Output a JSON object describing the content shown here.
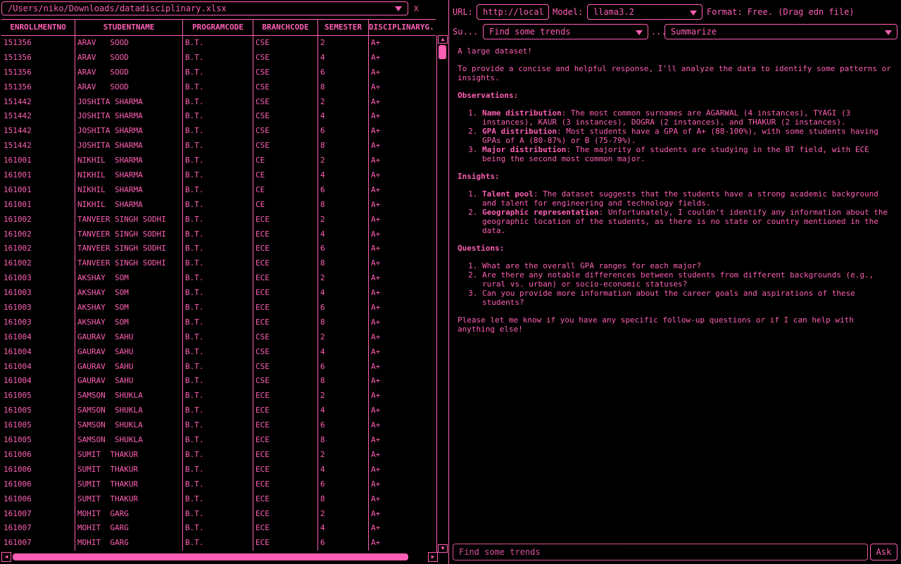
{
  "file": {
    "path": "/Users/niko/Downloads/datadisciplinary.xlsx",
    "close": "X"
  },
  "table": {
    "headers": [
      "ENROLLMENTNO",
      "STUDENTNAME",
      "PROGRAMCODE",
      "BRANCHCODE",
      "SEMESTER",
      "DISCIPLINARYG..."
    ],
    "rows": [
      [
        "151356",
        "ARAV   SOOD",
        "B.T.",
        "CSE",
        "2",
        "A+"
      ],
      [
        "151356",
        "ARAV   SOOD",
        "B.T.",
        "CSE",
        "4",
        "A+"
      ],
      [
        "151356",
        "ARAV   SOOD",
        "B.T.",
        "CSE",
        "6",
        "A+"
      ],
      [
        "151356",
        "ARAV   SOOD",
        "B.T.",
        "CSE",
        "8",
        "A+"
      ],
      [
        "151442",
        "JOSHITA SHARMA",
        "B.T.",
        "CSE",
        "2",
        "A+"
      ],
      [
        "151442",
        "JOSHITA SHARMA",
        "B.T.",
        "CSE",
        "4",
        "A+"
      ],
      [
        "151442",
        "JOSHITA SHARMA",
        "B.T.",
        "CSE",
        "6",
        "A+"
      ],
      [
        "151442",
        "JOSHITA SHARMA",
        "B.T.",
        "CSE",
        "8",
        "A+"
      ],
      [
        "161001",
        "NIKHIL  SHARMA",
        "B.T.",
        "CE",
        "2",
        "A+"
      ],
      [
        "161001",
        "NIKHIL  SHARMA",
        "B.T.",
        "CE",
        "4",
        "A+"
      ],
      [
        "161001",
        "NIKHIL  SHARMA",
        "B.T.",
        "CE",
        "6",
        "A+"
      ],
      [
        "161001",
        "NIKHIL  SHARMA",
        "B.T.",
        "CE",
        "8",
        "A+"
      ],
      [
        "161002",
        "TANVEER SINGH SODHI",
        "B.T.",
        "ECE",
        "2",
        "A+"
      ],
      [
        "161002",
        "TANVEER SINGH SODHI",
        "B.T.",
        "ECE",
        "4",
        "A+"
      ],
      [
        "161002",
        "TANVEER SINGH SODHI",
        "B.T.",
        "ECE",
        "6",
        "A+"
      ],
      [
        "161002",
        "TANVEER SINGH SODHI",
        "B.T.",
        "ECE",
        "8",
        "A+"
      ],
      [
        "161003",
        "AKSHAY  SOM",
        "B.T.",
        "ECE",
        "2",
        "A+"
      ],
      [
        "161003",
        "AKSHAY  SOM",
        "B.T.",
        "ECE",
        "4",
        "A+"
      ],
      [
        "161003",
        "AKSHAY  SOM",
        "B.T.",
        "ECE",
        "6",
        "A+"
      ],
      [
        "161003",
        "AKSHAY  SOM",
        "B.T.",
        "ECE",
        "8",
        "A+"
      ],
      [
        "161004",
        "GAURAV  SAHU",
        "B.T.",
        "CSE",
        "2",
        "A+"
      ],
      [
        "161004",
        "GAURAV  SAHU",
        "B.T.",
        "CSE",
        "4",
        "A+"
      ],
      [
        "161004",
        "GAURAV  SAHU",
        "B.T.",
        "CSE",
        "6",
        "A+"
      ],
      [
        "161004",
        "GAURAV  SAHU",
        "B.T.",
        "CSE",
        "8",
        "A+"
      ],
      [
        "161005",
        "SAMSON  SHUKLA",
        "B.T.",
        "ECE",
        "2",
        "A+"
      ],
      [
        "161005",
        "SAMSON  SHUKLA",
        "B.T.",
        "ECE",
        "4",
        "A+"
      ],
      [
        "161005",
        "SAMSON  SHUKLA",
        "B.T.",
        "ECE",
        "6",
        "A+"
      ],
      [
        "161005",
        "SAMSON  SHUKLA",
        "B.T.",
        "ECE",
        "8",
        "A+"
      ],
      [
        "161006",
        "SUMIT  THAKUR",
        "B.T.",
        "ECE",
        "2",
        "A+"
      ],
      [
        "161006",
        "SUMIT  THAKUR",
        "B.T.",
        "ECE",
        "4",
        "A+"
      ],
      [
        "161006",
        "SUMIT  THAKUR",
        "B.T.",
        "ECE",
        "6",
        "A+"
      ],
      [
        "161006",
        "SUMIT  THAKUR",
        "B.T.",
        "ECE",
        "8",
        "A+"
      ],
      [
        "161007",
        "MOHIT  GARG",
        "B.T.",
        "ECE",
        "2",
        "A+"
      ],
      [
        "161007",
        "MOHIT  GARG",
        "B.T.",
        "ECE",
        "4",
        "A+"
      ],
      [
        "161007",
        "MOHIT  GARG",
        "B.T.",
        "ECE",
        "6",
        "A+"
      ]
    ]
  },
  "settings": {
    "url_label": "URL:",
    "url_value": "http://local",
    "model_label": "Model:",
    "model_value": "llama3.2",
    "format_text": "Format: Free. (Drag edn file)",
    "su_label": "Su...",
    "trend_value": "Find some trends",
    "ellipsis": "...",
    "summary_value": "Summarize"
  },
  "response": {
    "intro": "A large dataset!",
    "p1": "To provide a concise and helpful response, I'll analyze the data to identify some patterns or insights.",
    "obs_title": "Observations:",
    "observations": [
      {
        "b": "Name distribution",
        "t": ": The most common surnames are AGARWAL (4 instances), TYAGI (3 instances), KAUR (3 instances), DOGRA (2 instances), and THAKUR (2 instances)."
      },
      {
        "b": "GPA distribution",
        "t": ": Most students have a GPA of A+ (88-100%), with some students having GPAs of A (80-87%) or B (75-79%)."
      },
      {
        "b": "Major distribution",
        "t": ": The majority of students are studying in the BT field, with ECE being the second most common major."
      }
    ],
    "ins_title": "Insights:",
    "insights": [
      {
        "b": "Talent pool",
        "t": ": The dataset suggests that the students have a strong academic background and talent for engineering and technology fields."
      },
      {
        "b": "Geographic representation",
        "t": ": Unfortunately, I couldn't identify any information about the geographic location of the students, as there is no state or country mentioned in the data."
      }
    ],
    "q_title": "Questions:",
    "questions": [
      "What are the overall GPA ranges for each major?",
      "Are there any notable differences between students from different backgrounds (e.g., rural vs. urban) or socio-economic statuses?",
      "Can you provide more information about the career goals and aspirations of these students?"
    ],
    "closing": "Please let me know if you have any specific follow-up questions or if I can help with anything else!"
  },
  "ask": {
    "placeholder": "Find some trends",
    "button": "Ask"
  }
}
